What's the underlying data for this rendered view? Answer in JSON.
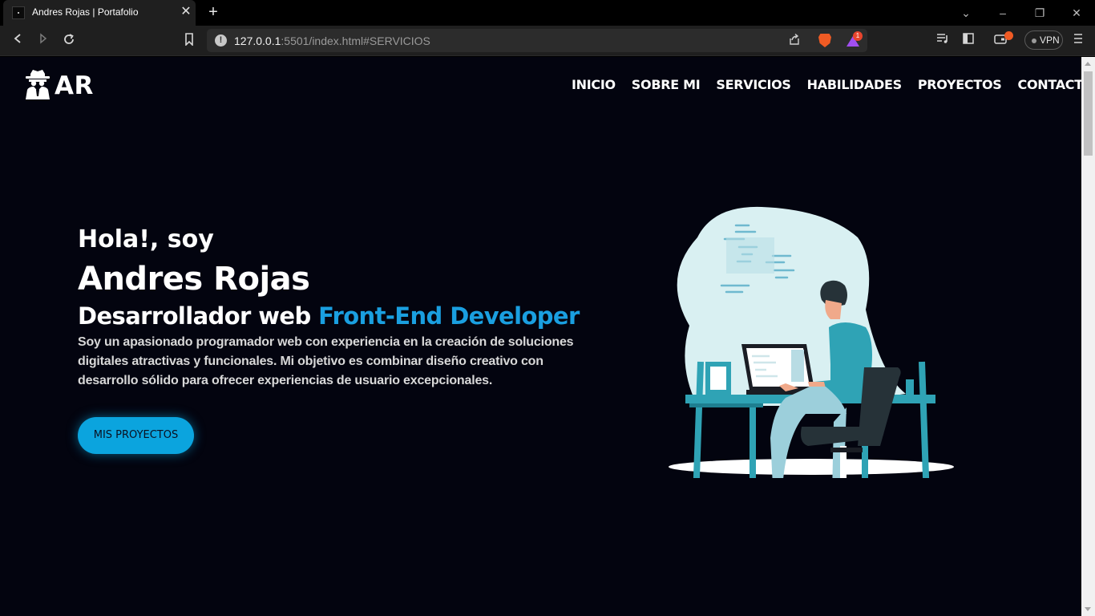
{
  "browser": {
    "tab_title": "Andres Rojas | Portafolio",
    "close_glyph": "✕",
    "new_tab_glyph": "+",
    "url_host": "127.0.0.1",
    "url_path": ":5501/index.html#SERVICIOS",
    "vpn_label": "VPN",
    "rewards_badge": "1",
    "icons": [
      "back-icon",
      "forward-icon",
      "reload-icon",
      "bookmark-icon",
      "info-icon",
      "share-icon",
      "brave-shields-icon",
      "brave-rewards-icon",
      "playlist-icon",
      "sidebar-icon",
      "wallet-icon",
      "menu-icon"
    ]
  },
  "site": {
    "logo_text": "AR",
    "nav": [
      "INICIO",
      "SOBRE MI",
      "SERVICIOS",
      "HABILIDADES",
      "PROYECTOS",
      "CONTACTO"
    ]
  },
  "hero": {
    "greeting": "Hola!, soy",
    "name": "Andres Rojas",
    "role_prefix": "Desarrollador web",
    "role_accent": "Front-End Developer",
    "description": "Soy un apasionado programador web con experiencia en la creación de soluciones digitales atractivas y funcionales. Mi objetivo es combinar diseño creativo con desarrollo sólido para ofrecer experiencias de usuario excepcionales.",
    "cta_label": "MIS PROYECTOS"
  },
  "colors": {
    "page_bg": "#03040f",
    "accent": "#1a9fe0",
    "button": "#0ba4de",
    "teal": "#2fa3b5"
  }
}
